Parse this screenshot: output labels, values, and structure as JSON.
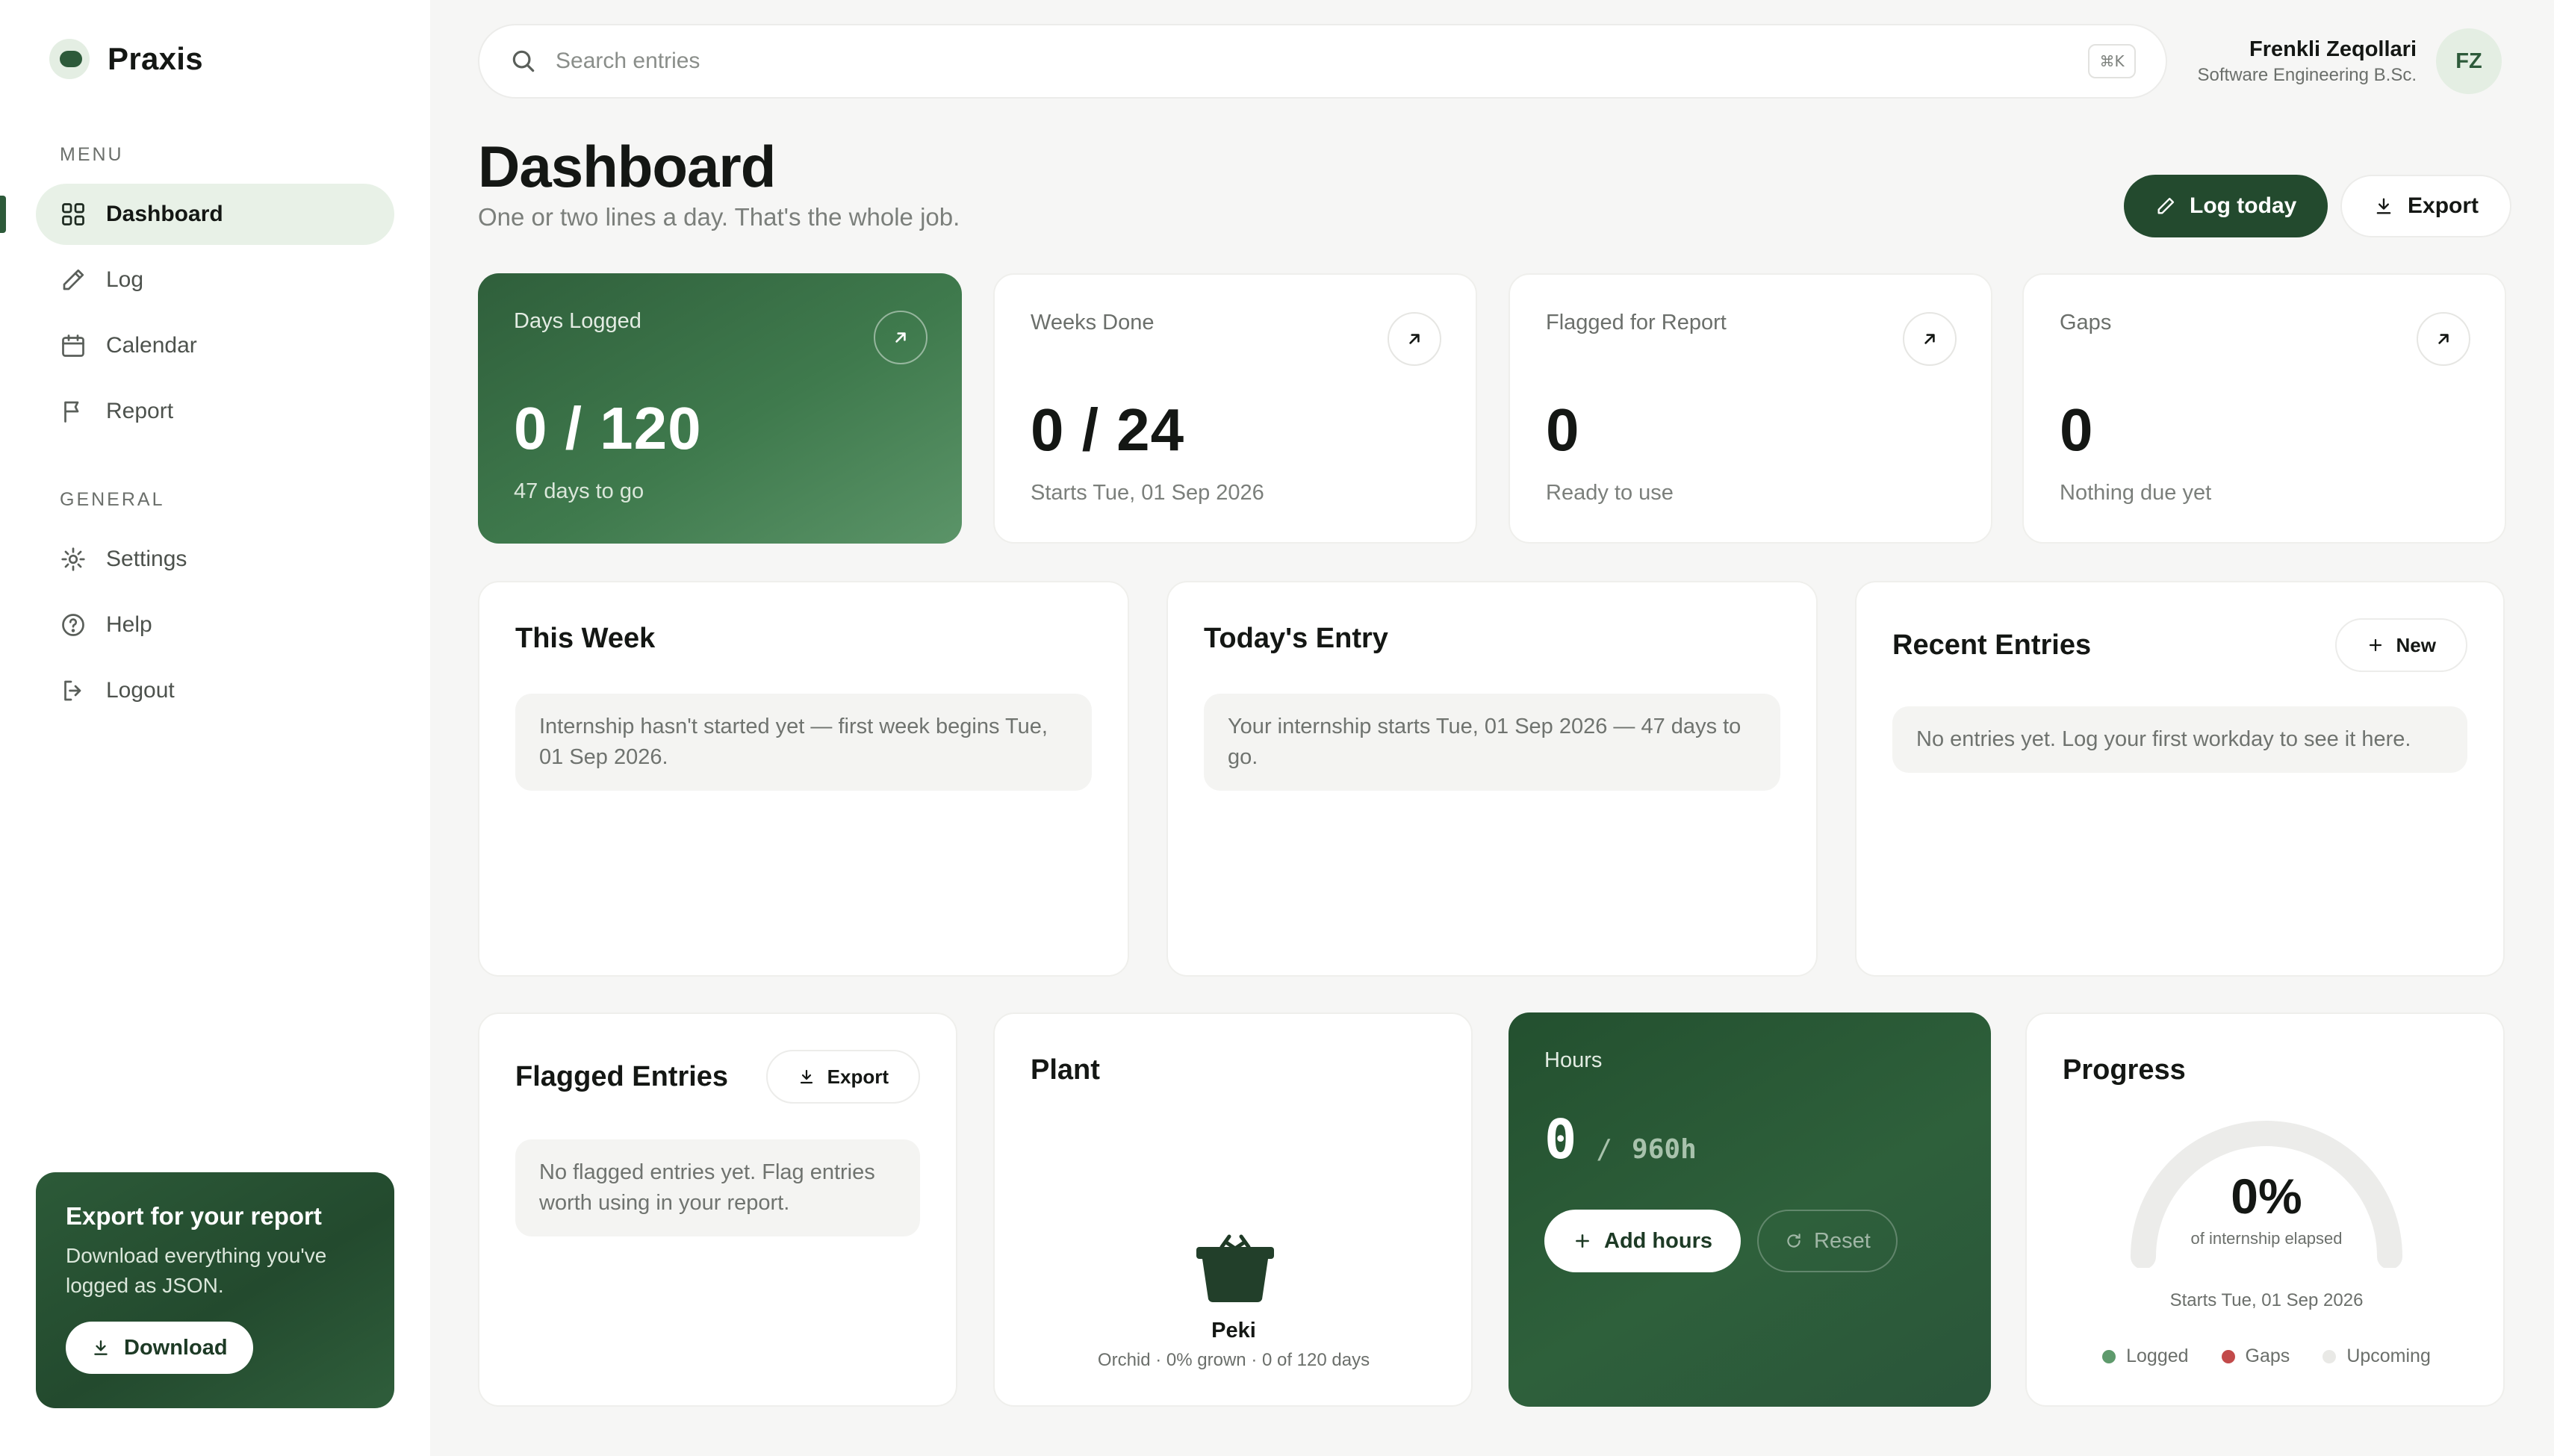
{
  "brand": {
    "name": "Praxis"
  },
  "sidebar": {
    "menu_label": "MENU",
    "general_label": "GENERAL",
    "menu_items": [
      {
        "label": "Dashboard",
        "icon": "grid-icon",
        "active": true
      },
      {
        "label": "Log",
        "icon": "pencil-icon"
      },
      {
        "label": "Calendar",
        "icon": "calendar-icon"
      },
      {
        "label": "Report",
        "icon": "flag-icon"
      }
    ],
    "general_items": [
      {
        "label": "Settings",
        "icon": "gear-icon"
      },
      {
        "label": "Help",
        "icon": "help-icon"
      },
      {
        "label": "Logout",
        "icon": "logout-icon"
      }
    ],
    "export_card": {
      "title": "Export for your report",
      "text": "Download everything you've logged as JSON.",
      "button": "Download"
    }
  },
  "search": {
    "placeholder": "Search entries",
    "shortcut": "⌘K"
  },
  "user": {
    "name": "Frenkli Zeqollari",
    "subtitle": "Software Engineering B.Sc.",
    "initials": "FZ"
  },
  "header": {
    "title": "Dashboard",
    "subtitle": "One or two lines a day. That's the whole job.",
    "log_button": "Log today",
    "export_button": "Export"
  },
  "stats": [
    {
      "label": "Days Logged",
      "value": "0 / 120",
      "sub": "47 days to go"
    },
    {
      "label": "Weeks Done",
      "value": "0 / 24",
      "sub": "Starts Tue, 01 Sep 2026"
    },
    {
      "label": "Flagged for Report",
      "value": "0",
      "sub": "Ready to use"
    },
    {
      "label": "Gaps",
      "value": "0",
      "sub": "Nothing due yet"
    }
  ],
  "this_week": {
    "title": "This Week",
    "message": "Internship hasn't started yet — first week begins Tue, 01 Sep 2026."
  },
  "todays_entry": {
    "title": "Today's Entry",
    "message": "Your internship starts Tue, 01 Sep 2026 — 47 days to go."
  },
  "recent_entries": {
    "title": "Recent Entries",
    "new_button": "New",
    "message": "No entries yet. Log your first workday to see it here."
  },
  "flagged_entries": {
    "title": "Flagged Entries",
    "export_button": "Export",
    "message": "No flagged entries yet. Flag entries worth using in your report."
  },
  "plant": {
    "title": "Plant",
    "name": "Peki",
    "details": "Orchid · 0% grown · 0 of 120 days",
    "icon": "plant-pot-icon"
  },
  "hours": {
    "title": "Hours",
    "logged": "0",
    "separator": "/",
    "total": "960h",
    "add_button": "Add hours",
    "reset_button": "Reset"
  },
  "progress": {
    "title": "Progress",
    "percent": "0%",
    "fraction": 0,
    "caption": "of internship elapsed",
    "start": "Starts Tue, 01 Sep 2026",
    "legend": [
      {
        "label": "Logged",
        "color": "#5e9a6c"
      },
      {
        "label": "Gaps",
        "color": "#c24a4a"
      },
      {
        "label": "Upcoming",
        "color": "#e9e9e6"
      }
    ]
  },
  "colors": {
    "accent": "#2d5a3a",
    "accent_light": "#e8f1e7",
    "background": "#f6f6f5"
  }
}
